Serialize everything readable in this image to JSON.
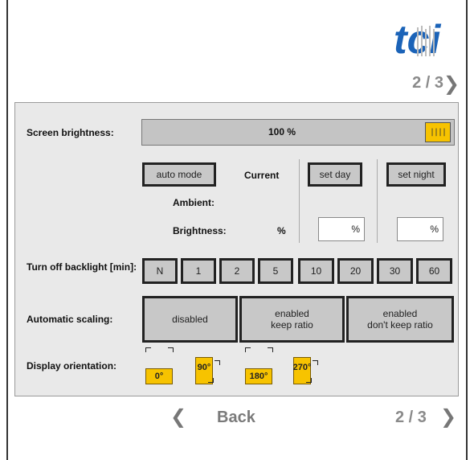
{
  "header": {
    "logo_text": "tci",
    "page_indicator": "2 / 3"
  },
  "brightness": {
    "label": "Screen brightness:",
    "value_text": "100 %",
    "level_percent": 100,
    "handle_glyph": "||||"
  },
  "ambient": {
    "auto_mode": "auto mode",
    "current_label": "Current",
    "set_day": "set day",
    "set_night": "set night",
    "ambient_label": "Ambient:",
    "brightness_label": "Brightness:",
    "current_unit": "%",
    "day_value": "%",
    "night_value": "%"
  },
  "backlight": {
    "label": "Turn off backlight [min]:",
    "options": [
      "N",
      "1",
      "2",
      "5",
      "10",
      "20",
      "30",
      "60"
    ]
  },
  "scaling": {
    "label": "Automatic scaling:",
    "options": [
      {
        "line1": "disabled",
        "line2": ""
      },
      {
        "line1": "enabled",
        "line2": "keep ratio"
      },
      {
        "line1": "enabled",
        "line2": "don't keep ratio"
      }
    ]
  },
  "orientation": {
    "label": "Display orientation:",
    "options": [
      "0°",
      "90°",
      "180°",
      "270°"
    ],
    "accent": "#f7c300"
  },
  "nav": {
    "back_label": "Back",
    "page_indicator": "2 / 3",
    "prev_icon": "chevron-left-icon",
    "next_icon": "chevron-right-icon"
  }
}
